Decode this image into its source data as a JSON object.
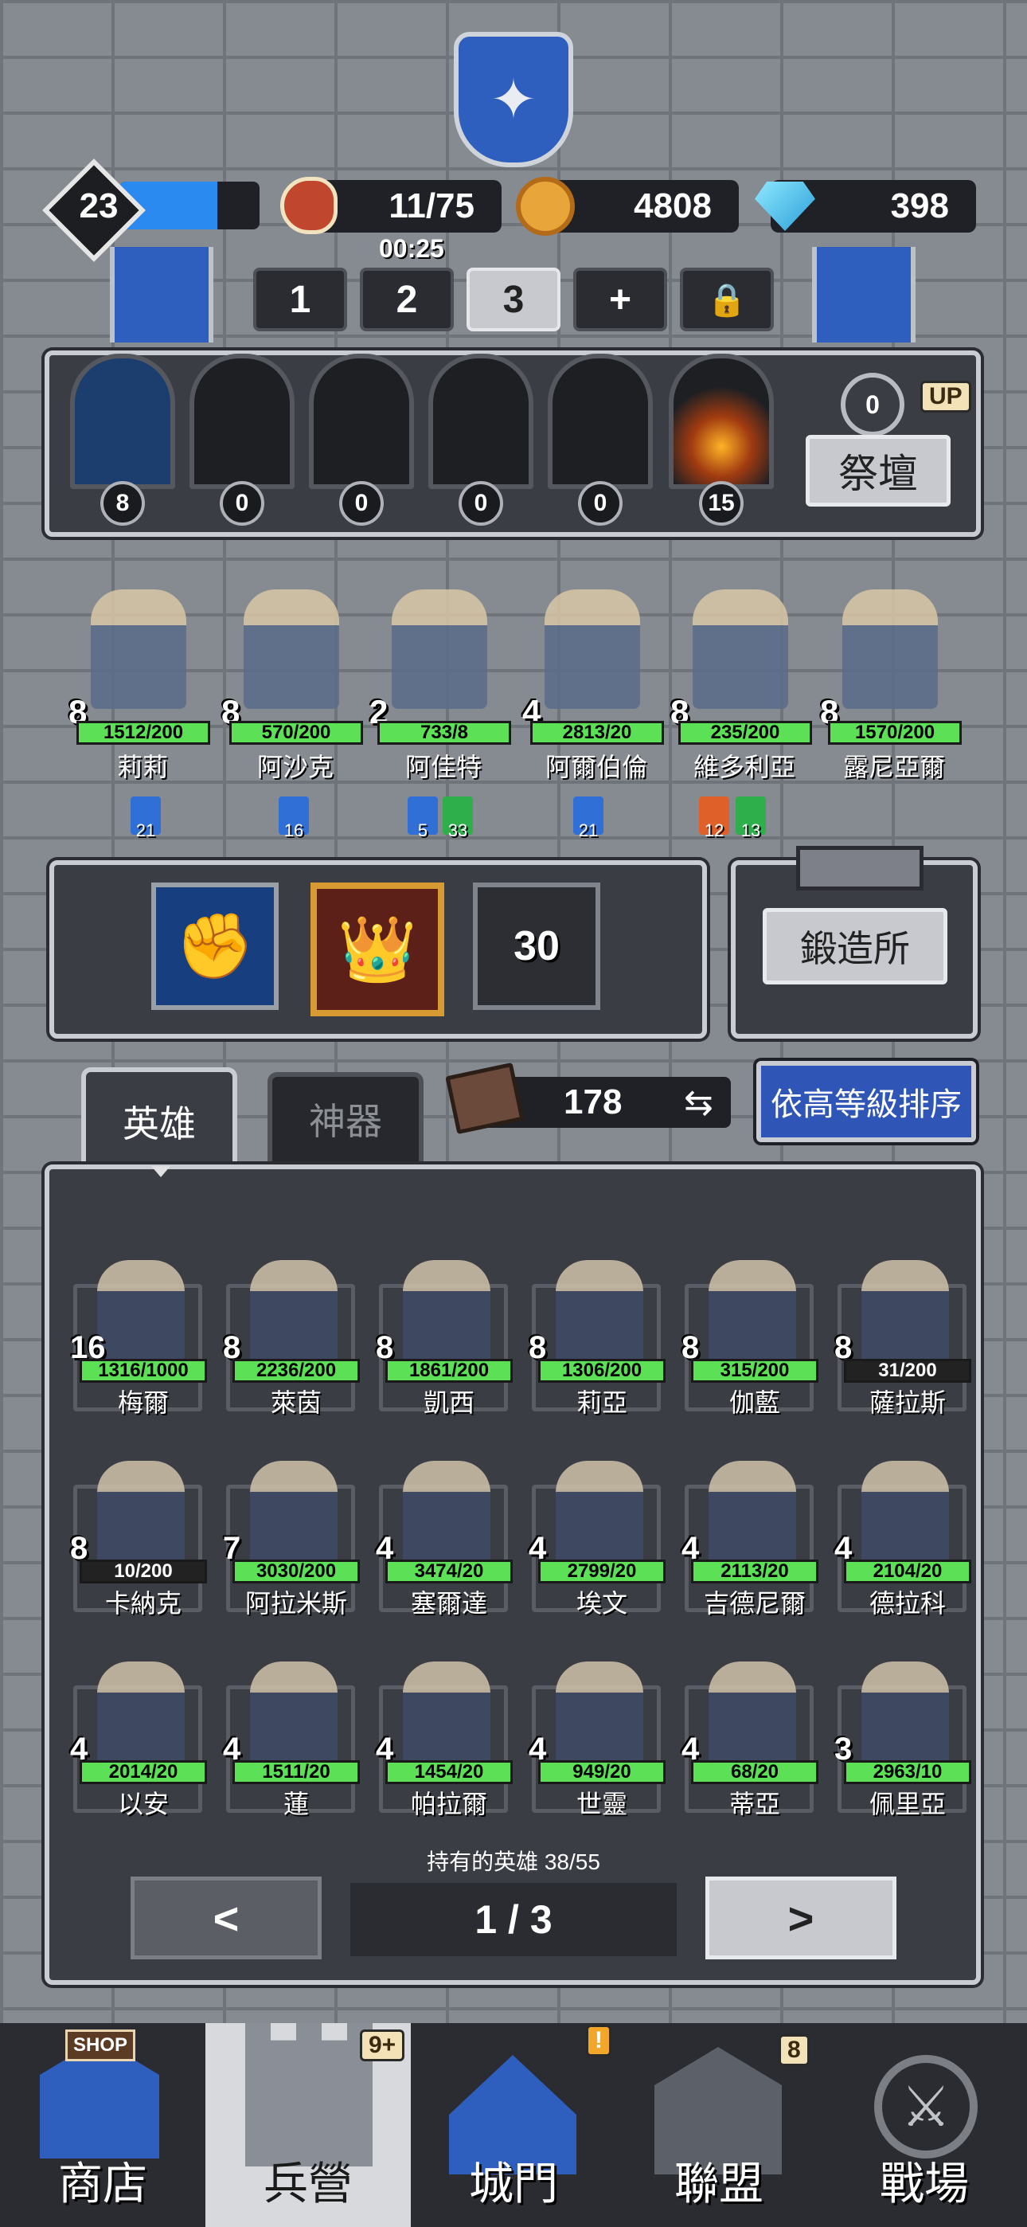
{
  "status_bar": {
    "level": "23",
    "food": "11/75",
    "food_timer": "00:25",
    "gold": "4808",
    "gems": "398"
  },
  "team_tabs": [
    "1",
    "2",
    "3",
    "+"
  ],
  "selected_team_tab": "3",
  "shrines": [
    "8",
    "0",
    "0",
    "0",
    "0",
    "15"
  ],
  "altar": {
    "label": "祭壇",
    "count": "0",
    "up": "UP"
  },
  "team": [
    {
      "level": "8",
      "xp": "1512/200",
      "name": "莉莉"
    },
    {
      "level": "8",
      "xp": "570/200",
      "name": "阿沙克"
    },
    {
      "level": "2",
      "xp": "733/8",
      "name": "阿佳特"
    },
    {
      "level": "4",
      "xp": "2813/20",
      "name": "阿爾伯倫"
    },
    {
      "level": "8",
      "xp": "235/200",
      "name": "維多利亞"
    },
    {
      "level": "8",
      "xp": "1570/200",
      "name": "露尼亞爾"
    }
  ],
  "team_badges": [
    {
      "value": "21",
      "color": "#2f6fd6"
    },
    {
      "value": "16",
      "color": "#2f6fd6"
    },
    {
      "value": "5",
      "color": "#2f6fd6"
    },
    {
      "value": "33",
      "color": "#2fae4c"
    },
    {
      "value": "21",
      "color": "#2f6fd6"
    },
    {
      "value": "12",
      "color": "#e0602a"
    },
    {
      "value": "13",
      "color": "#2fae4c"
    }
  ],
  "skills": {
    "locked_level": "30",
    "forge_label": "鍛造所"
  },
  "inventory_tabs": {
    "heroes": "英雄",
    "artifacts": "神器"
  },
  "book_count": "178",
  "sort_button": "依高等級排序",
  "heroes": [
    {
      "level": "16",
      "xp": "1316/1000",
      "name": "梅爾"
    },
    {
      "level": "8",
      "xp": "2236/200",
      "name": "萊茵"
    },
    {
      "level": "8",
      "xp": "1861/200",
      "name": "凱西"
    },
    {
      "level": "8",
      "xp": "1306/200",
      "name": "莉亞"
    },
    {
      "level": "8",
      "xp": "315/200",
      "name": "伽藍"
    },
    {
      "level": "8",
      "xp": "31/200",
      "name": "薩拉斯"
    },
    {
      "level": "8",
      "xp": "10/200",
      "name": "卡納克"
    },
    {
      "level": "7",
      "xp": "3030/200",
      "name": "阿拉米斯"
    },
    {
      "level": "4",
      "xp": "3474/20",
      "name": "塞爾達"
    },
    {
      "level": "4",
      "xp": "2799/20",
      "name": "埃文"
    },
    {
      "level": "4",
      "xp": "2113/20",
      "name": "吉德尼爾"
    },
    {
      "level": "4",
      "xp": "2104/20",
      "name": "德拉科"
    },
    {
      "level": "4",
      "xp": "2014/20",
      "name": "以安"
    },
    {
      "level": "4",
      "xp": "1511/20",
      "name": "蓮"
    },
    {
      "level": "4",
      "xp": "1454/20",
      "name": "帕拉爾"
    },
    {
      "level": "4",
      "xp": "949/20",
      "name": "世靈"
    },
    {
      "level": "4",
      "xp": "68/20",
      "name": "蒂亞"
    },
    {
      "level": "3",
      "xp": "2963/10",
      "name": "佩里亞"
    }
  ],
  "owned_heroes": "持有的英雄 38/55",
  "pagination": {
    "prev": "<",
    "page": "1 / 3",
    "next": ">"
  },
  "bottom_nav": [
    {
      "label": "商店",
      "sign": "SHOP",
      "badge": ""
    },
    {
      "label": "兵營",
      "badge": "9+"
    },
    {
      "label": "城門",
      "badge": "!"
    },
    {
      "label": "聯盟",
      "badge": "8"
    },
    {
      "label": "戰場",
      "badge": ""
    }
  ],
  "colors": {
    "accent_blue": "#2a8af0",
    "xp_green": "#5be056",
    "sort_button": "#2f55b7",
    "banner_blue": "#2e5fbf"
  }
}
